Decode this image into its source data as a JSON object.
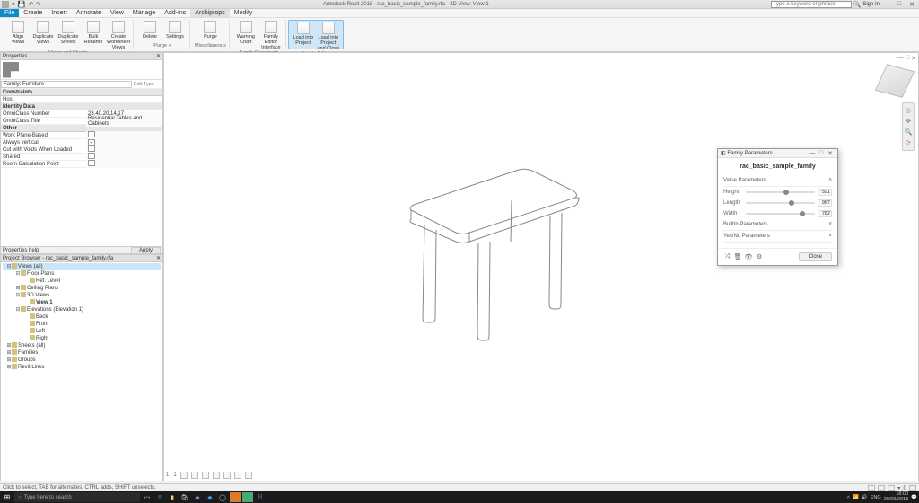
{
  "titlebar": {
    "app": "Autodesk Revit 2018",
    "doc": "rac_basic_sample_family.rfa - 3D View: View 1",
    "search_placeholder": "Type a keyword or phrase",
    "signin": "Sign In"
  },
  "menu": {
    "file": "File",
    "items": [
      "Create",
      "Insert",
      "Annotate",
      "View",
      "Manage",
      "Add-Ins",
      "Archiprops",
      "Modify"
    ]
  },
  "ribbon": {
    "groups": [
      {
        "label": "Views and Sheets",
        "btns": [
          "Align Views",
          "Duplicate Views",
          "Duplicate Sheets",
          "Bulk Rename",
          "Create Worksheet Views"
        ]
      },
      {
        "label": "Purge +",
        "btns": [
          "Delete",
          "Settings"
        ]
      },
      {
        "label": "Miscellaneous",
        "btns": [
          "Purge"
        ]
      },
      {
        "label": "Family Document",
        "btns": [
          "Warning Chart",
          "Family Editor Interface"
        ]
      },
      {
        "label": "Family Editor",
        "btns": [
          "Load into Project",
          "Load into Project and Close"
        ],
        "highlight": true
      }
    ]
  },
  "properties": {
    "header": "Properties",
    "family_type": "Family: Furniture",
    "edit_type": "Edit Type",
    "sections": [
      {
        "title": "Constraints",
        "rows": [
          {
            "lab": "Host",
            "val": ""
          }
        ]
      },
      {
        "title": "Identity Data",
        "rows": [
          {
            "lab": "OmniClass Number",
            "val": "23.40.20.14.17"
          },
          {
            "lab": "OmniClass Title",
            "val": "Residential Tables and Cabinets"
          }
        ]
      },
      {
        "title": "Other",
        "rows": [
          {
            "lab": "Work Plane-Based",
            "chk": false
          },
          {
            "lab": "Always vertical",
            "chk": true
          },
          {
            "lab": "Cut with Voids When Loaded",
            "chk": false
          },
          {
            "lab": "Shared",
            "chk": false
          },
          {
            "lab": "Room Calculation Point",
            "chk": false
          }
        ]
      }
    ],
    "help": "Properties help",
    "apply": "Apply"
  },
  "browser": {
    "header": "Project Browser - rac_basic_sample_family.rfa",
    "items": [
      {
        "l": 0,
        "t": "Views (all)",
        "sel": true,
        "exp": "-"
      },
      {
        "l": 1,
        "t": "Floor Plans",
        "exp": "-"
      },
      {
        "l": 2,
        "t": "Ref. Level"
      },
      {
        "l": 1,
        "t": "Ceiling Plans",
        "exp": "+"
      },
      {
        "l": 1,
        "t": "3D Views",
        "exp": "-"
      },
      {
        "l": 2,
        "t": "View 1",
        "bold": true
      },
      {
        "l": 1,
        "t": "Elevations (Elevation 1)",
        "exp": "-"
      },
      {
        "l": 2,
        "t": "Back"
      },
      {
        "l": 2,
        "t": "Front"
      },
      {
        "l": 2,
        "t": "Left"
      },
      {
        "l": 2,
        "t": "Right"
      },
      {
        "l": 0,
        "t": "Sheets (all)",
        "exp": "+"
      },
      {
        "l": 0,
        "t": "Families",
        "exp": "+"
      },
      {
        "l": 0,
        "t": "Groups",
        "exp": "+"
      },
      {
        "l": 0,
        "t": "Revit Links",
        "exp": "+"
      }
    ]
  },
  "dialog": {
    "title": "Family Parameters",
    "header": "rac_basic_sample_family",
    "sections": {
      "value": {
        "label": "Value Parameters",
        "params": [
          {
            "name": "Height",
            "val": "591",
            "thumb": 55
          },
          {
            "name": "Length",
            "val": "987",
            "thumb": 62
          },
          {
            "name": "Width",
            "val": "782",
            "thumb": 78
          }
        ]
      },
      "builtin": {
        "label": "BuiltIn Parameters"
      },
      "yesno": {
        "label": "Yes/No Parameters"
      }
    },
    "close": "Close"
  },
  "status": {
    "left": "Click to select, TAB for alternates, CTRL adds, SHIFT unselects.",
    "filter": "0"
  },
  "viewport": {
    "scale": "1 : 1"
  },
  "taskbar": {
    "search": "Type here to search",
    "time": "18:00",
    "date": "20/09/2018",
    "lang": "ENG"
  }
}
